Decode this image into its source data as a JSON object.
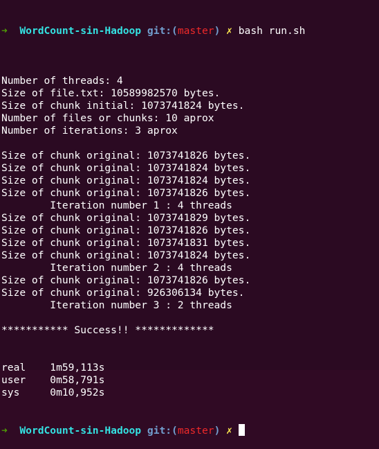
{
  "prompt": {
    "arrow": "➜",
    "directory": "WordCount-sin-Hadoop",
    "git_prefix": "git:(",
    "branch": "master",
    "git_suffix": ")",
    "dirty_mark": "✗"
  },
  "command": "bash run.sh",
  "output_lines": [
    "",
    "Number of threads: 4",
    "Size of file.txt: 10589982570 bytes.",
    "Size of chunk initial: 1073741824 bytes.",
    "Number of files or chunks: 10 aprox",
    "Number of iterations: 3 aprox",
    "",
    "Size of chunk original: 1073741826 bytes.",
    "Size of chunk original: 1073741824 bytes.",
    "Size of chunk original: 1073741824 bytes.",
    "Size of chunk original: 1073741826 bytes.",
    "        Iteration number 1 : 4 threads",
    "Size of chunk original: 1073741829 bytes.",
    "Size of chunk original: 1073741826 bytes.",
    "Size of chunk original: 1073741831 bytes.",
    "Size of chunk original: 1073741824 bytes.",
    "        Iteration number 2 : 4 threads",
    "Size of chunk original: 1073741826 bytes.",
    "Size of chunk original: 926306134 bytes.",
    "        Iteration number 3 : 2 threads",
    "",
    "*********** Success!! *************",
    "",
    "",
    "real    1m59,113s",
    "user    0m58,791s",
    "sys     0m10,952s"
  ],
  "colors": {
    "background": "#2b0a22",
    "text": "#ffffff",
    "arrow": "#4e9a06",
    "directory": "#34e2e2",
    "git": "#729fcf",
    "branch": "#ef2929",
    "dirty_mark": "#fce94f"
  }
}
